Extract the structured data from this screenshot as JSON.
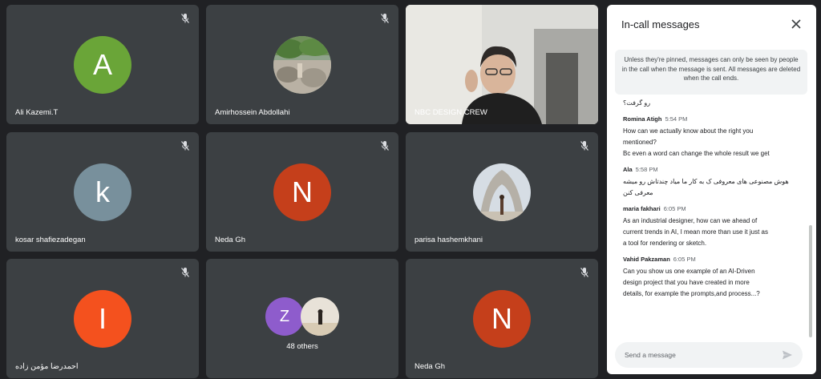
{
  "participants": [
    {
      "name": "Ali Kazemi.T",
      "initial": "A",
      "color": "#6aa538"
    },
    {
      "name": "Amirhossein Abdollahi"
    },
    {
      "name": "NBC DESIGN CREW"
    },
    {
      "name": "kosar shafiezadegan",
      "initial": "k",
      "color": "#78909c"
    },
    {
      "name": "Neda Gh",
      "initial": "N",
      "color": "#c53f1b"
    },
    {
      "name": "parisa hashemkhani"
    },
    {
      "name": "احمدرضا مؤمن زاده",
      "initial": "I",
      "color": "#f4511e"
    },
    {
      "others_initial": "Z",
      "others_color": "#8e5ccc",
      "others_label": "48 others"
    },
    {
      "name": "Neda Gh",
      "initial": "N",
      "color": "#c53f1b"
    }
  ],
  "chat": {
    "title": "In-call messages",
    "close_icon": "close-icon",
    "notice": "Unless they're pinned, messages can only be seen by people in the call when the message is sent. All messages are deleted when the call ends.",
    "messages": [
      {
        "sender": "",
        "time": "",
        "lines": [
          "رو گرفت؟"
        ],
        "rtl": true
      },
      {
        "sender": "Romina Atigh",
        "time": "5:54 PM",
        "lines": [
          "How can we actually know about the right you",
          "mentioned?",
          "Bc even a word can change the whole result we get"
        ]
      },
      {
        "sender": "Ala",
        "time": "5:58 PM",
        "lines": [
          "هوش مصنوعی های معروفی ک به کار ما میاد چندتاش رو میشه",
          "معرفی کنن"
        ],
        "rtl": true
      },
      {
        "sender": "maria fakhari",
        "time": "6:05 PM",
        "lines": [
          "As an industrial designer, how can we ahead of",
          "current trends in AI, I mean more than use it just as",
          "a tool for rendering or sketch."
        ]
      },
      {
        "sender": "Vahid Pakzaman",
        "time": "6:05 PM",
        "lines": [
          "Can you show us one example of an AI-Driven",
          "design project that you have created in more",
          "details, for example the prompts,and process...?"
        ]
      }
    ],
    "composer_placeholder": "Send a message",
    "send_icon": "send-icon"
  },
  "icons": {
    "mic_muted": "mic-off-icon"
  }
}
